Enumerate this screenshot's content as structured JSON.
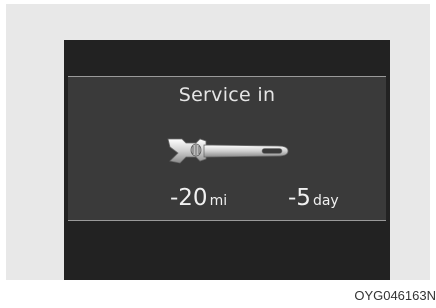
{
  "display": {
    "title": "Service in",
    "icon": "wrench-icon",
    "distance": {
      "value": "-20",
      "unit": "mi"
    },
    "time": {
      "value": "-5",
      "unit": "day"
    }
  },
  "figure_code": "OYG046163N",
  "colors": {
    "screen_bg": "#222222",
    "panel_bg": "#3a3a3a",
    "text": "#f0f0f0",
    "frame_bg": "#e8e8e8"
  }
}
